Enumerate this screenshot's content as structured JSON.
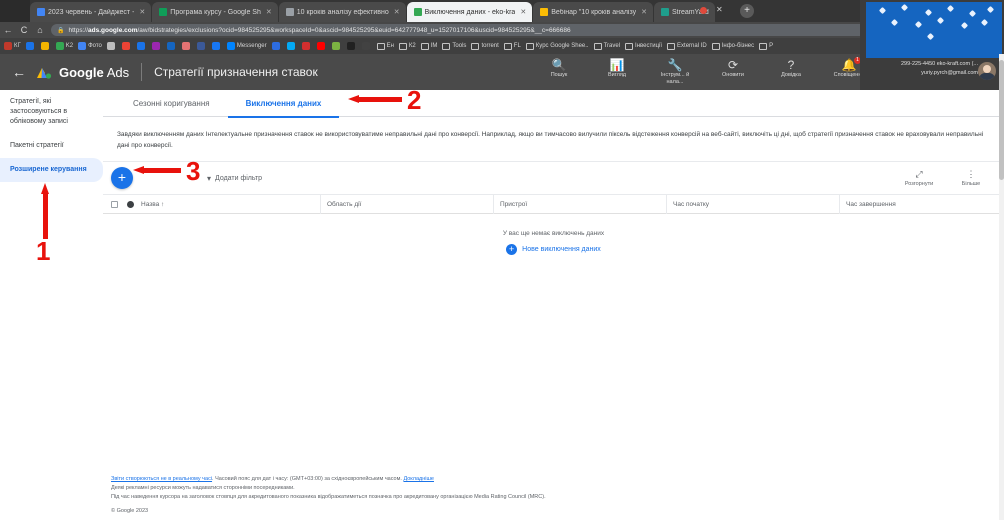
{
  "browser": {
    "tabs": [
      {
        "label": "2023 червень - Дайджест - ",
        "favicon_color": "#4285f4",
        "active": false
      },
      {
        "label": "Програма курсу - Google Sh",
        "favicon_color": "#0f9d58",
        "active": false
      },
      {
        "label": "10 кроків аналізу ефективно",
        "favicon_color": "#9aa0a6",
        "active": false
      },
      {
        "label": "Виключення даних - eko-kra",
        "favicon_color": "#34a853",
        "active": true
      },
      {
        "label": "Вебінар \"10 кроків аналізу ",
        "favicon_color": "#fbbc04",
        "active": false
      },
      {
        "label": "StreamYard",
        "favicon_color": "#1f9e8c",
        "active": false
      }
    ],
    "close_label": "✕",
    "new_tab_label": "+",
    "nav": {
      "back": "←",
      "forward": "→",
      "reload": "C",
      "home": "⌂"
    },
    "url_prefix": "https://",
    "url_bold": "ads.google.com",
    "url_rest": "/aw/bidstrategies/exclusions?ocid=984525295&workspaceId=0&ascid=984525295&euid=642777948_u=1527017106&uscid=984525295&__c=666686",
    "lock_icon": "🔒",
    "omni_icons": [
      "★",
      "⬛",
      "⬛",
      "⬛",
      "⬛",
      "⬛",
      "⬛",
      "⬛",
      "⋮"
    ],
    "bookmarks": [
      {
        "label": "КГ",
        "type": "icon",
        "color": "#c0392b"
      },
      {
        "label": "",
        "type": "icon",
        "color": "#1a73e8"
      },
      {
        "label": "",
        "type": "icon",
        "color": "#f4b400"
      },
      {
        "label": "K2",
        "type": "icon",
        "color": "#34a853"
      },
      {
        "label": "Фото",
        "type": "icon",
        "color": "#4285f4"
      },
      {
        "label": "",
        "type": "icon",
        "color": "#bdbdbd"
      },
      {
        "label": "",
        "type": "icon",
        "color": "#ea4335"
      },
      {
        "label": "",
        "type": "icon",
        "color": "#1a73e8"
      },
      {
        "label": "",
        "type": "icon",
        "color": "#9c27b0"
      },
      {
        "label": "",
        "type": "icon",
        "color": "#1565c0"
      },
      {
        "label": "",
        "type": "icon",
        "color": "#e57373"
      },
      {
        "label": "",
        "type": "icon",
        "color": "#3b5998"
      },
      {
        "label": "",
        "type": "icon",
        "color": "#1877f2"
      },
      {
        "label": "Messenger",
        "type": "icon",
        "color": "#0084ff"
      },
      {
        "label": "",
        "type": "icon",
        "color": "#2d6cdf"
      },
      {
        "label": "",
        "type": "icon",
        "color": "#03a9f4"
      },
      {
        "label": "",
        "type": "icon",
        "color": "#d32f2f"
      },
      {
        "label": "",
        "type": "icon",
        "color": "#ff0000"
      },
      {
        "label": "",
        "type": "icon",
        "color": "#7cb342"
      },
      {
        "label": "",
        "type": "icon",
        "color": "#212121"
      },
      {
        "label": "",
        "type": "icon",
        "color": "#424242"
      },
      {
        "label": "Ен",
        "type": "folder"
      },
      {
        "label": "К2",
        "type": "folder"
      },
      {
        "label": "ІМ",
        "type": "folder"
      },
      {
        "label": "Tools",
        "type": "folder"
      },
      {
        "label": "torrent",
        "type": "folder"
      },
      {
        "label": "FL",
        "type": "folder"
      },
      {
        "label": "Курс Google Shee..",
        "type": "folder"
      },
      {
        "label": "Travel",
        "type": "folder"
      },
      {
        "label": "Інвестиції",
        "type": "folder"
      },
      {
        "label": "External ID",
        "type": "folder"
      },
      {
        "label": "Інфо-бізнес",
        "type": "folder"
      },
      {
        "label": "Р",
        "type": "folder"
      }
    ]
  },
  "appbar": {
    "back_label": "←",
    "brand_bold": "Google",
    "brand_light": "Ads",
    "page_title": "Стратегії призначення ставок",
    "actions": [
      {
        "icon": "search-icon",
        "glyph": "🔍",
        "label": "Пошук",
        "badge": ""
      },
      {
        "icon": "view-icon",
        "glyph": "📊",
        "label": "Вигляд",
        "badge": ""
      },
      {
        "icon": "tools-icon",
        "glyph": "🔧",
        "label": "Інструм... й нала...",
        "badge": ""
      },
      {
        "icon": "refresh-icon",
        "glyph": "⟳",
        "label": "Оновити",
        "badge": ""
      },
      {
        "icon": "help-icon",
        "glyph": "?",
        "label": "Довідка",
        "badge": ""
      },
      {
        "icon": "notifications-icon",
        "glyph": "🔔",
        "label": "Сповіщення",
        "badge": "1"
      }
    ],
    "account": {
      "line1": "299-225-4450 eko-kraft.com (...",
      "line2": "yuriy.pyrch@gmail.com"
    }
  },
  "sidebar": {
    "items": [
      {
        "label": "Стратегії, які застосовуються в обліковому записі",
        "active": false
      },
      {
        "label": "Пакетні стратегії",
        "active": false
      },
      {
        "label": "Розширене керування",
        "active": true
      }
    ]
  },
  "main": {
    "tabs": [
      {
        "label": "Сезонні коригування",
        "active": false
      },
      {
        "label": "Виключення даних",
        "active": true
      }
    ],
    "description": "Завдяки виключенням даних Інтелектуальне призначення ставок не використовуватиме неправильні дані про конверсії. Наприклад, якщо ви тимчасово вилучили піксель відстеження конверсій на веб-сайті, виключіть ці дні, щоб стратегії призначення ставок не враховували неправильні дані про конверсії.",
    "toolbar": {
      "add_label": "+",
      "filter_label": "Додати фільтр",
      "filter_icon": "▼",
      "expand_label": "Розгорнути",
      "expand_icon": "⤢",
      "more_label": "Більше",
      "more_icon": "⋮"
    },
    "table": {
      "columns": [
        {
          "label": "Назва",
          "sort": "↑"
        },
        {
          "label": "Область дії",
          "sort": ""
        },
        {
          "label": "Пристрої",
          "sort": ""
        },
        {
          "label": "Час початку",
          "sort": ""
        },
        {
          "label": "Час завершення",
          "sort": ""
        }
      ],
      "rows": [],
      "empty_text": "У вас ще немає виключень даних",
      "empty_action": "Нове виключення даних"
    },
    "footer": {
      "link1": "Звіти створюються не в реальному часі",
      "text1": ". Часовий пояс для дат і часу: (GMT+03:00) за східноєвропейським часом. ",
      "link2": "Докладніше",
      "line2": "Деякі рекламні ресурси можуть надаватися сторонніми посередниками.",
      "line3": "Під час наведення курсора на заголовок стовпця для акредитованого показника відображатиметься позначка про акредитовану організацією Media Rating Council (MRC).",
      "copyright": "© Google 2023"
    }
  },
  "annotations": {
    "marker1": "1",
    "marker2": "2",
    "marker3": "3"
  }
}
